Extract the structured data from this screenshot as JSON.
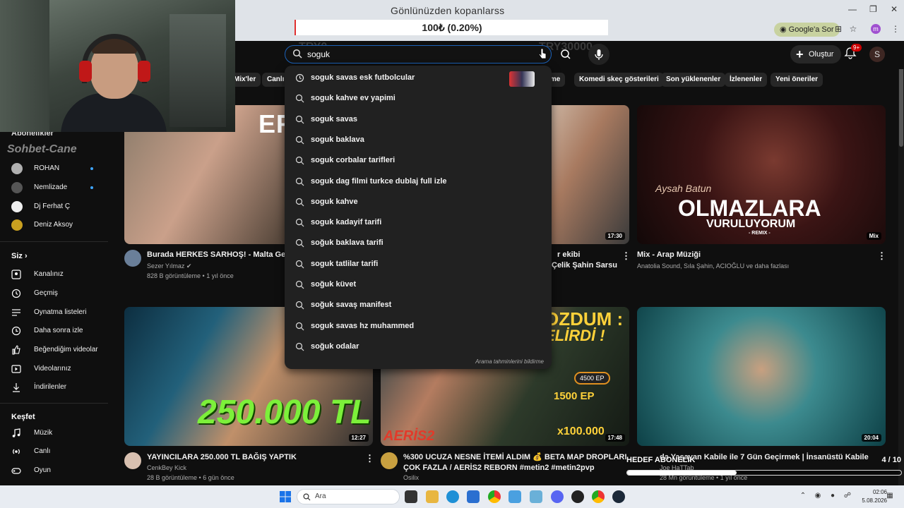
{
  "browser": {
    "tab_title": "Gönlünüzden kopanlarss",
    "donation": "100₺ (0.20%)",
    "google_ask": "Google'a Sor",
    "profile_letter": "m"
  },
  "header": {
    "ghost_left": "TRY0",
    "ghost_right": "TRY30000",
    "search_value": "soguk",
    "create_label": "Oluştur",
    "notif_badge": "9+",
    "avatar_letter": "S"
  },
  "chips": [
    "Mix'ler",
    "Canlı",
    "rme",
    "Komedi skeç gösterileri",
    "Son yüklenenler",
    "İzlenenler",
    "Yeni öneriler"
  ],
  "suggestions": [
    {
      "text": "soguk savas esk futbolcular",
      "type": "history"
    },
    {
      "text": "soguk kahve ev yapimi",
      "type": "search"
    },
    {
      "text": "soguk savas",
      "type": "search"
    },
    {
      "text": "soguk baklava",
      "type": "search"
    },
    {
      "text": "soguk corbalar tarifleri",
      "type": "search"
    },
    {
      "text": "soguk dag filmi turkce dublaj full izle",
      "type": "search"
    },
    {
      "text": "soguk kahve",
      "type": "search"
    },
    {
      "text": "soguk kadayif tarifi",
      "type": "search"
    },
    {
      "text": "soğuk baklava tarifi",
      "type": "search"
    },
    {
      "text": "soguk tatlilar tarifi",
      "type": "search"
    },
    {
      "text": "soğuk küvet",
      "type": "search"
    },
    {
      "text": "soğuk savaş manifest",
      "type": "search"
    },
    {
      "text": "soguk savas hz muhammed",
      "type": "search"
    },
    {
      "text": "soğuk odalar",
      "type": "search"
    }
  ],
  "disable_predictions": "Arama tahminlerini bildirme",
  "sidebar": {
    "subs_heading": "Abonelikler",
    "glitch": "Sohbet-Cane",
    "subs": [
      {
        "label": "ROHAN",
        "color": "#b0b0b0",
        "dot": true
      },
      {
        "label": "Nemlizade",
        "color": "#555555",
        "dot": true
      },
      {
        "label": "Dj Ferhat Ç",
        "color": "#eeeeee",
        "dot": false
      },
      {
        "label": "Deniz Aksoy",
        "color": "#c9a020",
        "dot": false
      }
    ],
    "you_heading": "Siz",
    "you_items": [
      {
        "label": "Kanalınız",
        "icon": "channel-icon"
      },
      {
        "label": "Geçmiş",
        "icon": "history-icon"
      },
      {
        "label": "Oynatma listeleri",
        "icon": "playlists-icon"
      },
      {
        "label": "Daha sonra izle",
        "icon": "watch-later-icon"
      },
      {
        "label": "Beğendiğim videolar",
        "icon": "like-icon"
      },
      {
        "label": "Videolarınız",
        "icon": "your-videos-icon"
      },
      {
        "label": "İndirilenler",
        "icon": "download-icon"
      }
    ],
    "explore_heading": "Keşfet",
    "explore_items": [
      {
        "label": "Müzik",
        "icon": "music-icon"
      },
      {
        "label": "Canlı",
        "icon": "live-icon"
      },
      {
        "label": "Oyun",
        "icon": "gaming-icon"
      }
    ]
  },
  "videos": [
    {
      "title": "Burada HERKES SARHOŞ! - Malta Gece H",
      "channel": "Sezer Yılmaz",
      "meta": "828 B görüntüleme • 1 yıl önce",
      "duration": "",
      "thumb_text": "ERKES"
    },
    {
      "title": "r ekibi",
      "title2": "Çelik Şahin Sarsu",
      "channel": "",
      "meta": "",
      "duration": "17:30",
      "thumb_text": ""
    },
    {
      "title": "Mix - Arap Müziği",
      "channel": "Anatolia Sound, Sıla Şahin, ACIOĞLU ve daha fazlası",
      "meta": "",
      "duration": "Mix",
      "thumb_text": "OLMAZLARA",
      "thumb_sub": "VURULUYORUM",
      "thumb_remix": "- REMIX -",
      "thumb_script": "Aysah Batun"
    },
    {
      "title": "YAYINCILARA 250.000 TL BAĞIŞ YAPTIK",
      "channel": "CenkBey Kick",
      "meta": "28 B görüntüleme • 6 gün önce",
      "duration": "12:27",
      "thumb_text": "250.000 TL"
    },
    {
      "title": "%300 UCUZA NESNE İTEMİ ALDIM 💰 BETA MAP DROPLARI",
      "title2": "ÇOK FAZLA / AERİS2 REBORN #metin2 #metin2pvp",
      "channel": "Osilix",
      "meta": "",
      "duration": "17:48",
      "thumb_text": "OZDUM :",
      "thumb_text2": "ELİRDİ !",
      "thumb_ep": "1500 EP",
      "thumb_ep2": "4500 EP",
      "thumb_x": "x100.000",
      "thumb_brand": "AERİS2"
    },
    {
      "title": "da Yaşayan Kabile ile 7 Gün Geçirmek | İnsanüstü Kabile",
      "channel": "Joe HaTTab",
      "meta": "28 Mn görüntüleme • 1 yıl önce",
      "duration": "20:04",
      "thumb_text": ""
    }
  ],
  "widget": {
    "label": "HEDEF ABONELİK",
    "count": "4 / 10",
    "progress": 0.4
  },
  "taskbar": {
    "search_placeholder": "Ara",
    "time": "02:06",
    "date": "5.08.2026"
  },
  "colors": {
    "accent_blue": "#1c62b9",
    "live_red": "#cc0000",
    "progress_green": "#3ea6ff"
  }
}
